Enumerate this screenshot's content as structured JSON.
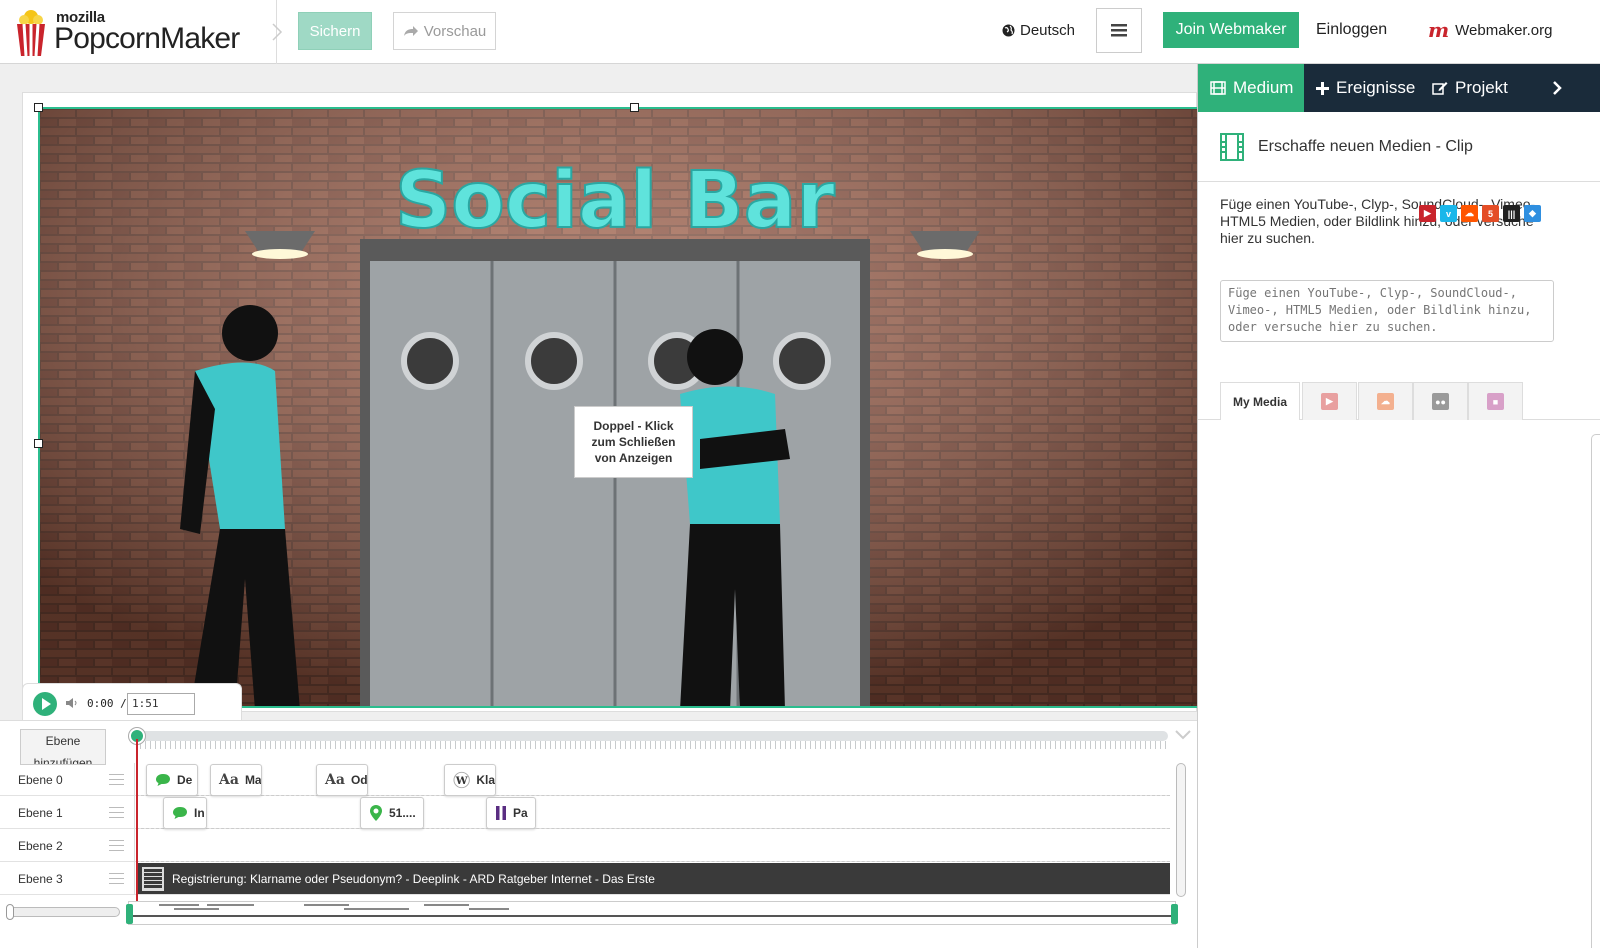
{
  "header": {
    "logo_small": "mozilla",
    "logo_name": "PopcornMaker",
    "save_label": "Sichern",
    "preview_label": "Vorschau",
    "language": "Deutsch",
    "join_label": "Join Webmaker",
    "login_label": "Einloggen",
    "webmaker_label": "Webmaker.org"
  },
  "stage": {
    "tooltip": "Doppel - Klick zum Schließen von Anzeigen",
    "video_sign": "Social Bar"
  },
  "player": {
    "current_time": "0:00",
    "separator": "/",
    "duration": "1:51"
  },
  "timeline": {
    "add_layer": "Ebene hinzufügen",
    "layers": [
      {
        "label": "Ebene 0"
      },
      {
        "label": "Ebene 1"
      },
      {
        "label": "Ebene 2"
      },
      {
        "label": "Ebene 3"
      }
    ],
    "events_layer0": [
      "De",
      "Ma",
      "Od",
      "Kla"
    ],
    "events_layer1": [
      "In",
      "51....",
      "Pa"
    ],
    "media_clip": "Registrierung: Klarname oder Pseudonym? - Deeplink - ARD Ratgeber Internet - Das Erste"
  },
  "panel": {
    "tabs": [
      {
        "label": "Medium"
      },
      {
        "label": "Ereignisse"
      },
      {
        "label": "Projekt"
      }
    ],
    "heading": "Erschaffe neuen Medien - Clip",
    "description": "Füge einen YouTube-, Clyp-, SoundCloud-, Vimeo-, HTML5 Medien, oder Bildlink hinzu, oder versuche hier zu suchen.",
    "search_placeholder": "Füge einen YouTube-, Clyp-, SoundCloud-, Vimeo-, HTML5 Medien, oder Bildlink hinzu, oder versuche hier zu suchen.",
    "source_tabs": [
      {
        "label": "My Media"
      }
    ]
  },
  "colors": {
    "accent_green": "#2fb17a",
    "nav_dark": "#1a2b3a",
    "playhead_red": "#c9242c"
  }
}
